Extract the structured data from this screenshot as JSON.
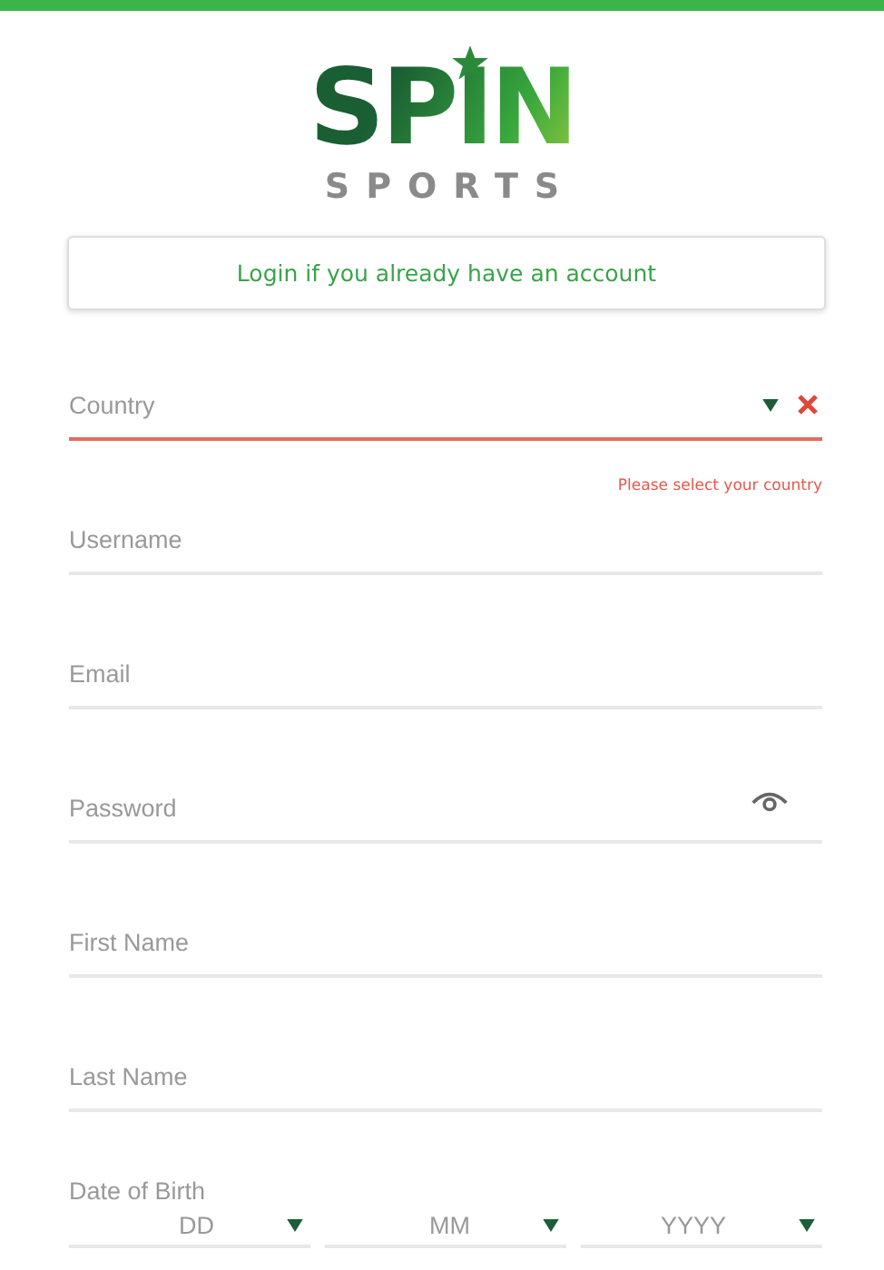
{
  "logo": {
    "word": "SPIN",
    "subword": "SPORTS"
  },
  "login_button": "Login if you already have an account",
  "fields": [
    {
      "kind": "select",
      "placeholder": "Country",
      "error": "Please select your country",
      "invalid": true
    },
    {
      "kind": "text",
      "placeholder": "Username",
      "invalid": false
    },
    {
      "kind": "text",
      "placeholder": "Email",
      "invalid": false
    },
    {
      "kind": "password",
      "placeholder": "Password",
      "invalid": false
    },
    {
      "kind": "text",
      "placeholder": "First Name",
      "invalid": false
    },
    {
      "kind": "text",
      "placeholder": "Last Name",
      "invalid": false
    }
  ],
  "date_of_birth": {
    "label": "Date of Birth",
    "parts": [
      "DD",
      "MM",
      "YYYY"
    ]
  }
}
